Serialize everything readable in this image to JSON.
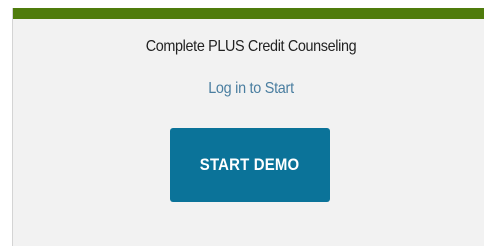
{
  "header": {
    "accent_color": "#4f7c0c"
  },
  "main": {
    "title": "Complete PLUS Credit Counseling",
    "login_link": "Log in to Start",
    "start_demo_label": "START DEMO",
    "button_color": "#0b7399"
  }
}
